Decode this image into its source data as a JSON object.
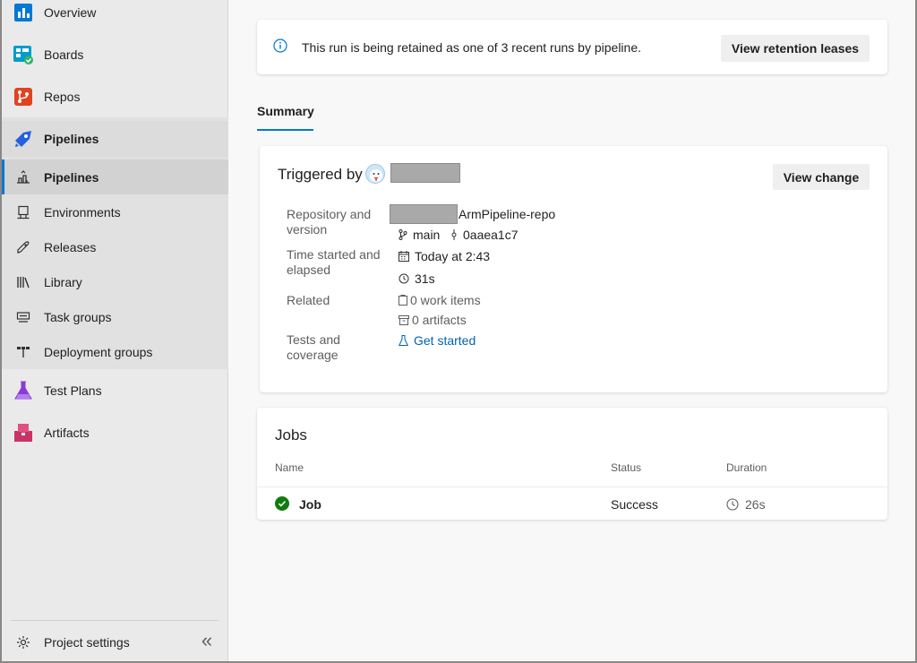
{
  "sidebar": {
    "items": [
      {
        "label": "Overview",
        "icon": "overview-icon"
      },
      {
        "label": "Boards",
        "icon": "boards-icon"
      },
      {
        "label": "Repos",
        "icon": "repos-icon"
      },
      {
        "label": "Pipelines",
        "icon": "pipelines-icon"
      },
      {
        "label": "Test Plans",
        "icon": "test-plans-icon"
      },
      {
        "label": "Artifacts",
        "icon": "artifacts-icon"
      }
    ],
    "sub_items": [
      {
        "label": "Pipelines",
        "icon": "pipeline-rocket-icon"
      },
      {
        "label": "Environments",
        "icon": "environments-icon"
      },
      {
        "label": "Releases",
        "icon": "releases-icon"
      },
      {
        "label": "Library",
        "icon": "library-icon"
      },
      {
        "label": "Task groups",
        "icon": "task-groups-icon"
      },
      {
        "label": "Deployment groups",
        "icon": "deployment-groups-icon"
      }
    ],
    "settings_label": "Project settings",
    "collapse_glyph": "«"
  },
  "banner": {
    "message": "This run is being retained as one of 3 recent runs by pipeline.",
    "button": "View retention leases"
  },
  "tabs": {
    "summary": "Summary"
  },
  "summary": {
    "triggered_by": "Triggered by",
    "view_change": "View change",
    "repo_label": "Repository and version",
    "repo_name": "ArmPipeline-repo",
    "branch": "main",
    "commit": "0aaea1c7",
    "time_label": "Time started and elapsed",
    "started": "Today at 2:43",
    "elapsed": "31s",
    "related_label": "Related",
    "work_items": "0 work items",
    "artifacts": "0 artifacts",
    "tests_label": "Tests and coverage",
    "get_started": "Get started"
  },
  "jobs": {
    "title": "Jobs",
    "columns": {
      "name": "Name",
      "status": "Status",
      "duration": "Duration"
    },
    "rows": [
      {
        "name": "Job",
        "status": "Success",
        "duration": "26s"
      }
    ]
  },
  "colors": {
    "accent": "#0078d4",
    "success": "#107c10",
    "link": "#0063b1"
  }
}
